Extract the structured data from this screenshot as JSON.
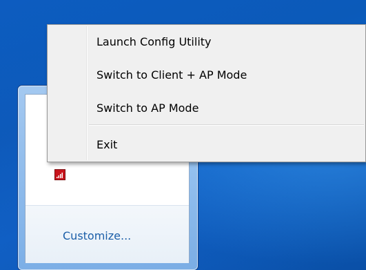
{
  "context_menu": {
    "items": [
      {
        "label": "Launch Config Utility"
      },
      {
        "label": "Switch to Client + AP Mode"
      },
      {
        "label": "Switch to AP Mode"
      },
      {
        "label": "Exit"
      }
    ]
  },
  "tray_flyout": {
    "customize_label": "Customize...",
    "icons": [
      {
        "name": "wireless-signal-icon",
        "color": "#c8141c"
      }
    ]
  },
  "colors": {
    "desktop": "#0b5ab9",
    "link": "#1b5ea8",
    "menu_background": "#f0f0f0"
  }
}
